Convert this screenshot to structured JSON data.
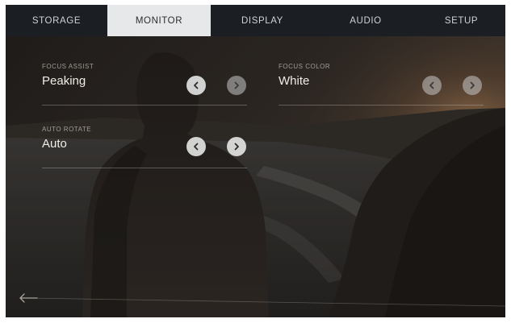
{
  "tabs": [
    {
      "label": "STORAGE"
    },
    {
      "label": "MONITOR",
      "active": true
    },
    {
      "label": "DISPLAY"
    },
    {
      "label": "AUDIO"
    },
    {
      "label": "SETUP"
    }
  ],
  "settings": {
    "focus_assist": {
      "label": "FOCUS ASSIST",
      "value": "Peaking"
    },
    "focus_color": {
      "label": "FOCUS COLOR",
      "value": "White"
    },
    "auto_rotate": {
      "label": "AUTO ROTATE",
      "value": "Auto"
    }
  },
  "icons": {
    "prev": "chevron-left-icon",
    "next": "chevron-right-icon",
    "back": "arrow-left-icon"
  },
  "colors": {
    "tab_bar": "#1b1e22",
    "tab_active": "#e7e8ea",
    "text": "#f0ede9"
  }
}
